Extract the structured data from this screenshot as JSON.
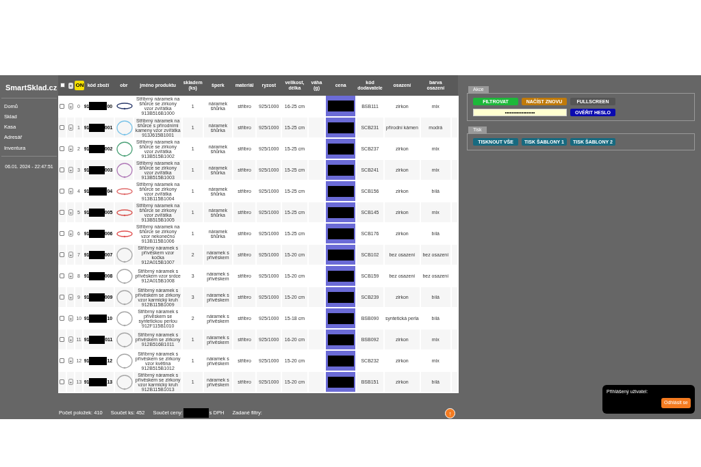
{
  "brand": "SmartSklad.cz",
  "nav": [
    {
      "label": "Domů"
    },
    {
      "label": "Sklad"
    },
    {
      "label": "Kasa"
    },
    {
      "label": "Adresář"
    },
    {
      "label": "Inventura"
    }
  ],
  "datetime": "06.01. 2024 - 22:47:51",
  "table": {
    "select_all_checked": false,
    "expand_label": "+",
    "toggle_label": "ON",
    "toggle_on": true,
    "columns": [
      "kód zboží",
      "obr",
      "jméno produktu",
      "skladem (ks)",
      "šperk",
      "materiál",
      "ryzost",
      "velikost, délka",
      "váha (g)",
      "cena",
      "kód dodavatele",
      "osazení",
      "barva osazení"
    ],
    "rows": [
      {
        "index": "0",
        "code_prefix": "91",
        "code_suffix": "00",
        "color": "#2b3a6b",
        "name": "Stříbrný náramek na šňůrce se zirkony vzor zvířátka 913B516B1000",
        "stock": "1",
        "jewel": "náramek šňůrka",
        "material": "stříbro",
        "purity": "925/1000",
        "size": "16-25 cm",
        "supplier_code": "BSB111",
        "setting": "zirkon",
        "setting_color": "mix",
        "checked": false
      },
      {
        "index": "1",
        "code_prefix": "91",
        "code_suffix": "001",
        "color": "#7cc4e8",
        "name": "Stříbrný náramek na šňůrce s přírodními kameny vzor zvířátka 913J615B1001",
        "stock": "1",
        "jewel": "náramek šňůrka",
        "material": "stříbro",
        "purity": "925/1000",
        "size": "15-25 cm",
        "supplier_code": "SCB231",
        "setting": "přírodní kámen",
        "setting_color": "modrá",
        "checked": false
      },
      {
        "index": "2",
        "code_prefix": "91",
        "code_suffix": "002",
        "color": "#4fa37a",
        "name": "Stříbrný náramek na šňůrce se zirkony vzor zvířátka 913B515B1002",
        "stock": "1",
        "jewel": "náramek šňůrka",
        "material": "stříbro",
        "purity": "925/1000",
        "size": "15-25 cm",
        "supplier_code": "SCB237",
        "setting": "zirkon",
        "setting_color": "mix",
        "checked": false
      },
      {
        "index": "3",
        "code_prefix": "91",
        "code_suffix": "003",
        "color": "#b07ab8",
        "name": "Stříbrný náramek na šňůrce se zirkony vzor zvířátka 913B515B1003",
        "stock": "1",
        "jewel": "náramek šňůrka",
        "material": "stříbro",
        "purity": "925/1000",
        "size": "15-25 cm",
        "supplier_code": "SCB241",
        "setting": "zirkon",
        "setting_color": "mix",
        "checked": false
      },
      {
        "index": "4",
        "code_prefix": "91",
        "code_suffix": "04",
        "color": "#e06a6a",
        "name": "Stříbrný náramek na šňůrce se zirkony vzor zvířátka 913B115B1004",
        "stock": "1",
        "jewel": "náramek šňůrka",
        "material": "stříbro",
        "purity": "925/1000",
        "size": "15-25 cm",
        "supplier_code": "SCB156",
        "setting": "zirkon",
        "setting_color": "bílá",
        "checked": false
      },
      {
        "index": "5",
        "code_prefix": "91",
        "code_suffix": "005",
        "color": "#d9534f",
        "name": "Stříbrný náramek na šňůrce se zirkony vzor zvířátka 913B515B1005",
        "stock": "1",
        "jewel": "náramek šňůrka",
        "material": "stříbro",
        "purity": "925/1000",
        "size": "15-25 cm",
        "supplier_code": "SCB145",
        "setting": "zirkon",
        "setting_color": "mix",
        "checked": false
      },
      {
        "index": "6",
        "code_prefix": "91",
        "code_suffix": "006",
        "color": "#e05050",
        "name": "Stříbrný náramek na šňůrce se zirkony vzor nekonečno 913B115B1006",
        "stock": "1",
        "jewel": "náramek šňůrka",
        "material": "stříbro",
        "purity": "925/1000",
        "size": "15-25 cm",
        "supplier_code": "SCB176",
        "setting": "zirkon",
        "setting_color": "bílá",
        "checked": false
      },
      {
        "index": "7",
        "code_prefix": "91",
        "code_suffix": "007",
        "color": "#a8a8a8",
        "name": "Stříbrný náramek s přívěskem vzor kočka 912A015B1007",
        "stock": "2",
        "jewel": "náramek s přívěskem",
        "material": "stříbro",
        "purity": "925/1000",
        "size": "15-20 cm",
        "supplier_code": "SCB102",
        "setting": "bez osazení",
        "setting_color": "bez osazení",
        "checked": false
      },
      {
        "index": "8",
        "code_prefix": "91",
        "code_suffix": "008",
        "color": "#a8a8a8",
        "name": "Stříbrný náramek s přívěskem vzor srdce 912A015B1008",
        "stock": "3",
        "jewel": "náramek s přívěskem",
        "material": "stříbro",
        "purity": "925/1000",
        "size": "15-20 cm",
        "supplier_code": "SCB159",
        "setting": "bez osazení",
        "setting_color": "bez osazení",
        "checked": false
      },
      {
        "index": "9",
        "code_prefix": "91",
        "code_suffix": "009",
        "color": "#a8a8a8",
        "name": "Stříbrný náramek s přívěskem se zirkony vzor karmický kruh 912B115B1009",
        "stock": "3",
        "jewel": "náramek s přívěskem",
        "material": "stříbro",
        "purity": "925/1000",
        "size": "15-20 cm",
        "supplier_code": "SCB239",
        "setting": "zirkon",
        "setting_color": "bílá",
        "checked": false
      },
      {
        "index": "10",
        "code_prefix": "91",
        "code_suffix": "10",
        "color": "#a8a8a8",
        "name": "Stříbrný náramek s přívěskem se syntetickou perlou 912F115B1010",
        "stock": "2",
        "jewel": "náramek s přívěskem",
        "material": "stříbro",
        "purity": "925/1000",
        "size": "15-18 cm",
        "supplier_code": "BSB090",
        "setting": "syntetická perla",
        "setting_color": "bílá",
        "checked": false
      },
      {
        "index": "11",
        "code_prefix": "91",
        "code_suffix": "011",
        "color": "#a8a8a8",
        "name": "Stříbrný náramek s přívěskem se zirkony 912B516B1011",
        "stock": "1",
        "jewel": "náramek s přívěskem",
        "material": "stříbro",
        "purity": "925/1000",
        "size": "16-20 cm",
        "supplier_code": "BSB092",
        "setting": "zirkon",
        "setting_color": "mix",
        "checked": false
      },
      {
        "index": "12",
        "code_prefix": "91",
        "code_suffix": "12",
        "color": "#a8a8a8",
        "name": "Stříbrný náramek s přívěskem se zirkony vzor květina 912B515B1012",
        "stock": "1",
        "jewel": "náramek s přívěskem",
        "material": "stříbro",
        "purity": "925/1000",
        "size": "15-20 cm",
        "supplier_code": "SCB232",
        "setting": "zirkon",
        "setting_color": "mix",
        "checked": false
      },
      {
        "index": "13",
        "code_prefix": "91",
        "code_suffix": "13",
        "color": "#a8a8a8",
        "name": "Stříbrný náramek s přívěskem se zirkony vzor karmický kruh 912B115B1013",
        "stock": "1",
        "jewel": "náramek s přívěskem",
        "material": "stříbro",
        "purity": "925/1000",
        "size": "15-20 cm",
        "supplier_code": "BSB151",
        "setting": "zirkon",
        "setting_color": "bílá",
        "checked": false
      }
    ]
  },
  "footer": {
    "item_count": "Počet položek: 410",
    "qty_sum": "Součet ks: 452",
    "price_sum_label": "Součet ceny:",
    "price_sum_suffix": "s DPH",
    "filters": "Zadané filtry:",
    "scroll_top_label": "↑"
  },
  "panels": [
    {
      "title": "Akce",
      "rows": [
        [
          {
            "kind": "button",
            "label": "FILTROVAT",
            "color": "#1db83a"
          },
          {
            "kind": "button",
            "label": "NAČÍST ZNOVU",
            "color": "#c07a0a"
          },
          {
            "kind": "button",
            "label": "FULLSCREEN",
            "color": "#555555"
          }
        ],
        [
          {
            "kind": "password",
            "value": "••••••••••••••••••",
            "colspan": 2
          },
          {
            "kind": "button",
            "label": "OVĚŘIT HESLO",
            "color": "#0a0ab0"
          }
        ]
      ]
    },
    {
      "title": "Tisk",
      "rows": [
        [
          {
            "kind": "button",
            "label": "TISKNOUT VŠE",
            "color": "#176a80"
          },
          {
            "kind": "button",
            "label": "TISK ŠABLONY 1",
            "color": "#176a80"
          },
          {
            "kind": "button",
            "label": "TISK ŠABLONY 2",
            "color": "#176a80"
          }
        ]
      ]
    }
  ],
  "user_box": {
    "label": "Přihlášený uživatel:",
    "logout": "Odhlásit se"
  }
}
